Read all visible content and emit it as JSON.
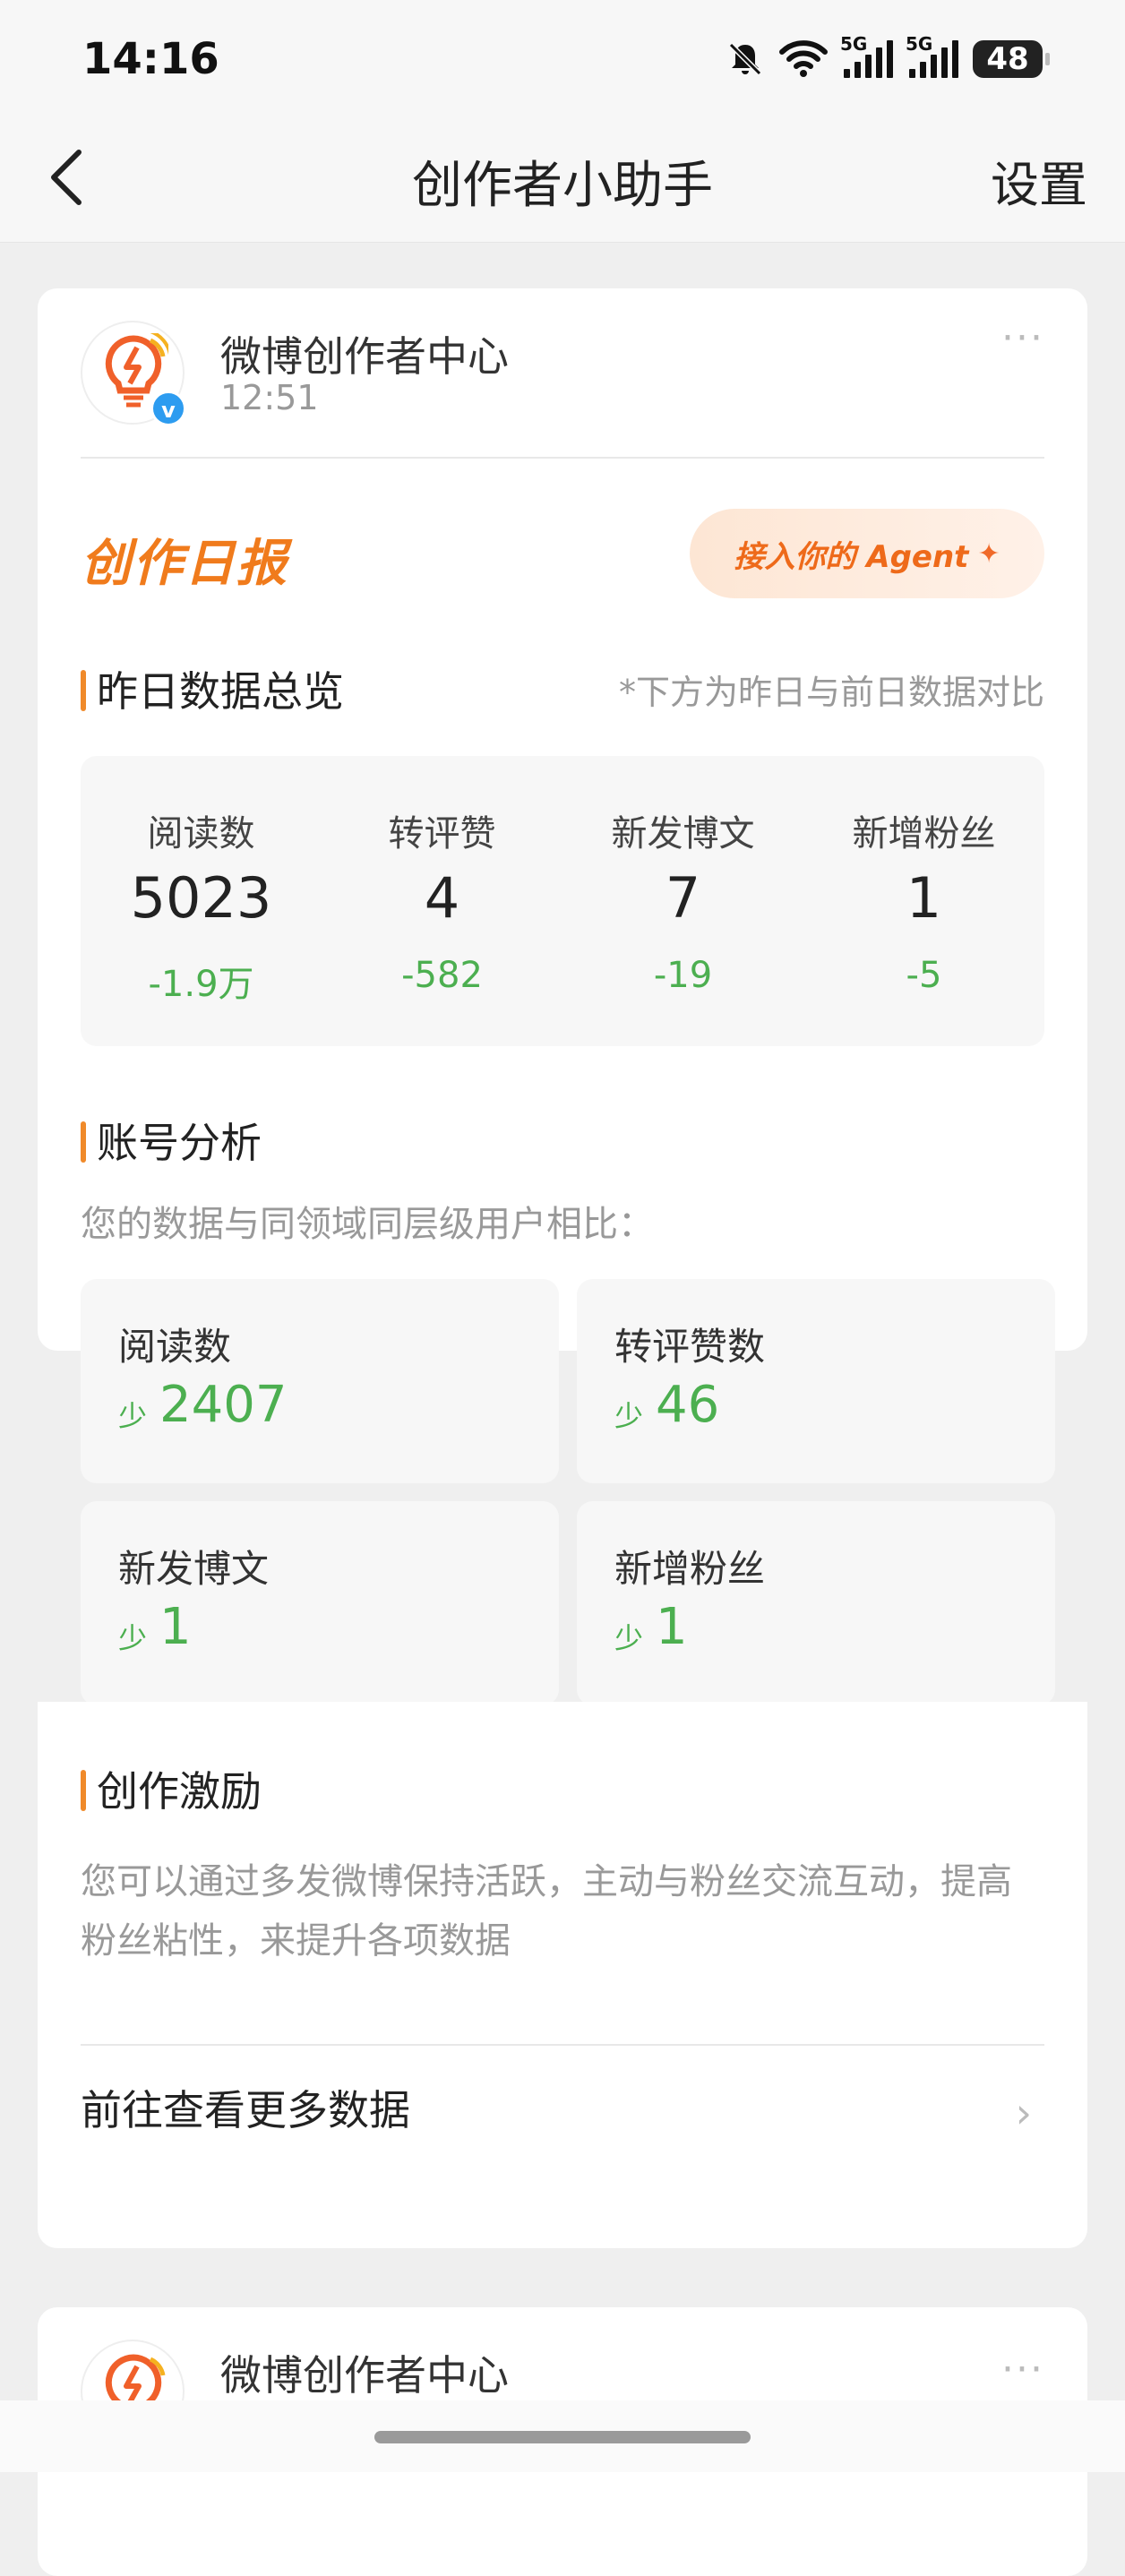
{
  "status_bar": {
    "time": "14:16",
    "battery": "48",
    "network1": "5G",
    "network2": "5G"
  },
  "nav": {
    "title": "创作者小助手",
    "settings": "设置"
  },
  "message": {
    "sender": "微博创作者中心",
    "time": "12:51",
    "report_title": "创作日报",
    "agent_button": "接入你的 Agent",
    "overview": {
      "title": "昨日数据总览",
      "note": "*下方为昨日与前日数据对比",
      "stats": [
        {
          "label": "阅读数",
          "value": "5023",
          "diff": "-1.9万"
        },
        {
          "label": "转评赞",
          "value": "4",
          "diff": "-582"
        },
        {
          "label": "新发博文",
          "value": "7",
          "diff": "-19"
        },
        {
          "label": "新增粉丝",
          "value": "1",
          "diff": "-5"
        }
      ]
    },
    "analysis": {
      "title": "账号分析",
      "subtitle": "您的数据与同领域同层级用户相比：",
      "items": [
        {
          "label": "阅读数",
          "tag": "少",
          "value": "2407"
        },
        {
          "label": "转评赞数",
          "tag": "少",
          "value": "46"
        },
        {
          "label": "新发博文",
          "tag": "少",
          "value": "1"
        },
        {
          "label": "新增粉丝",
          "tag": "少",
          "value": "1"
        }
      ]
    },
    "incentive": {
      "title": "创作激励",
      "text": "您可以通过多发微博保持活跃，主动与粉丝交流互动，提高粉丝粘性，来提升各项数据"
    },
    "more_link": "前往查看更多数据"
  },
  "next_message": {
    "sender": "微博创作者中心"
  },
  "colors": {
    "accent": "#f07b1c",
    "down": "#4caf50",
    "verify": "#2d9cf0"
  }
}
